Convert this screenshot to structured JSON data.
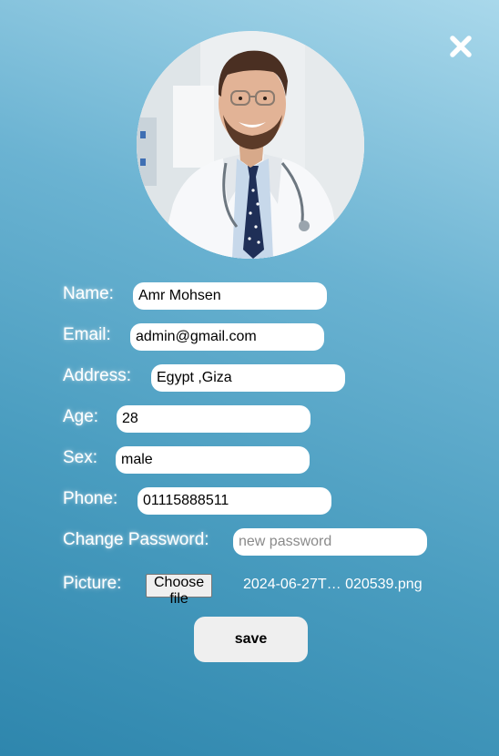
{
  "icons": {
    "close": "close-icon",
    "avatar": "doctor-photo"
  },
  "form": {
    "name": {
      "label": "Name:",
      "value": "Amr Mohsen"
    },
    "email": {
      "label": "Email:",
      "value": "admin@gmail.com"
    },
    "address": {
      "label": "Address:",
      "value": "Egypt ,Giza"
    },
    "age": {
      "label": "Age:",
      "value": "28"
    },
    "sex": {
      "label": "Sex:",
      "value": "male"
    },
    "phone": {
      "label": "Phone:",
      "value": "01115888511"
    },
    "password": {
      "label": "Change Password:",
      "value": "",
      "placeholder": "new password"
    },
    "picture": {
      "label": "Picture:",
      "button": "Choose file",
      "file_name": "2024-06-27T… 020539.png"
    }
  },
  "save_label": "save",
  "colors": {
    "gradient_top": "#a9d8eb",
    "gradient_bottom": "#2e86ad",
    "field_bg": "#ffffff",
    "button_bg": "#efefef"
  }
}
